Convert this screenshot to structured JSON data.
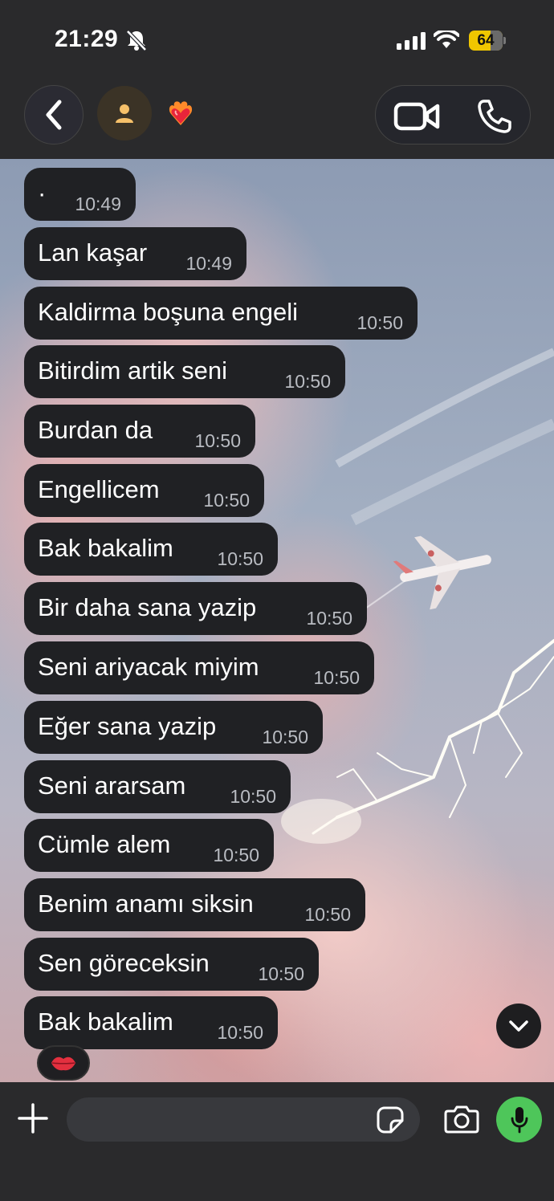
{
  "status_bar": {
    "time": "21:29",
    "battery_level": "64",
    "battery_fraction": 0.64
  },
  "header": {
    "contact_emoji": "❤️‍🔥",
    "icons": [
      "chevron-left-icon",
      "person-icon",
      "video-camera-icon",
      "phone-icon"
    ]
  },
  "messages": [
    {
      "text": "·",
      "time": "10:49"
    },
    {
      "text": "Lan kaşar",
      "time": "10:49"
    },
    {
      "text": "Kaldirma boşuna engeli",
      "time": "10:50"
    },
    {
      "text": "Bitirdim artik seni",
      "time": "10:50"
    },
    {
      "text": "Burdan da",
      "time": "10:50"
    },
    {
      "text": "Engellicem",
      "time": "10:50"
    },
    {
      "text": "Bak bakalim",
      "time": "10:50"
    },
    {
      "text": "Bir daha sana yazip",
      "time": "10:50"
    },
    {
      "text": "Seni ariyacak miyim",
      "time": "10:50"
    },
    {
      "text": "Eğer sana yazip",
      "time": "10:50"
    },
    {
      "text": "Seni ararsam",
      "time": "10:50"
    },
    {
      "text": "Cümle alem",
      "time": "10:50"
    },
    {
      "text": "Benim anamı siksin",
      "time": "10:50"
    },
    {
      "text": "Sen göreceksin",
      "time": "10:50"
    },
    {
      "text": "Bak bakalim",
      "time": "10:50"
    }
  ],
  "reaction": "💋",
  "input": {
    "value": "",
    "placeholder": ""
  },
  "colors": {
    "bubble": "#202124",
    "mic": "#4ec65a",
    "battery": "#f0c600"
  }
}
